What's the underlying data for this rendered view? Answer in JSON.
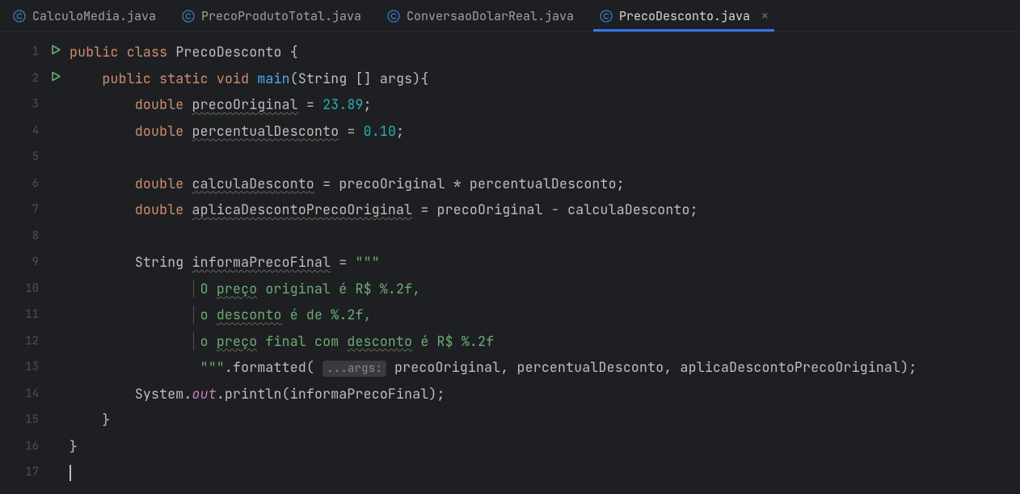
{
  "tabs": [
    {
      "label": "CalculoMedia.java"
    },
    {
      "label": "PrecoProdutoTotal.java"
    },
    {
      "label": "ConversaoDolarReal.java"
    },
    {
      "label": "PrecoDesconto.java",
      "active": true
    }
  ],
  "lineNumbers": [
    "1",
    "2",
    "3",
    "4",
    "5",
    "6",
    "7",
    "8",
    "9",
    "10",
    "11",
    "12",
    "13",
    "14",
    "15",
    "16",
    "17"
  ],
  "code": {
    "kw_public": "public",
    "kw_class": "class",
    "kw_static": "static",
    "kw_void": "void",
    "kw_double": "double",
    "cls_name": "PrecoDesconto",
    "fn_main": "main",
    "sig_args": "(String [] args){",
    "brace_open": " {",
    "brace_close": "}",
    "var_precoOriginal": "precoOriginal",
    "eq": " = ",
    "val_2389": "23.89",
    "semi": ";",
    "var_percentualDesconto": "percentualDesconto",
    "val_010": "0.10",
    "var_calculaDesconto": "calculaDesconto",
    "expr_calc": " = precoOriginal * percentualDesconto;",
    "var_aplicaDesconto": "aplicaDescontoPrecoOriginal",
    "expr_aplica": " = precoOriginal - calculaDesconto;",
    "type_String": "String ",
    "var_informaPrecoFinal": "informaPrecoFinal",
    "tripleq": "\"\"\"",
    "eq2": " = ",
    "s_line1a": "O ",
    "s_preco": "preço",
    "s_line1b": " original é R$ %.2f,",
    "s_line2a": "o ",
    "s_desconto": "desconto",
    "s_line2b": " é de %.2f,",
    "s_line3a": "o ",
    "s_line3b": " final com ",
    "s_line3c": " é R$ %.2f",
    "formatted": ".formatted( ",
    "hint_args": "...args:",
    "fmt_args": " precoOriginal, percentualDesconto, aplicaDescontoPrecoOriginal);",
    "sys": "System.",
    "out": "out",
    "println": ".println(informaPrecoFinal);"
  }
}
